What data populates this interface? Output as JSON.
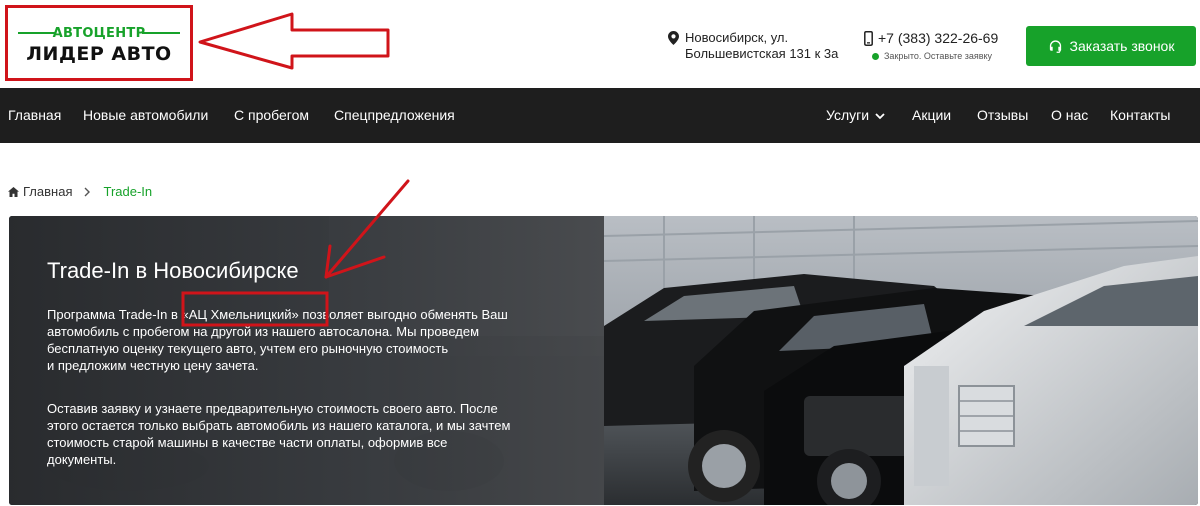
{
  "header": {
    "logo_top": "АВТОЦЕНТР",
    "logo_bottom": "ЛИДЕР АВТО",
    "address_line1": "Новосибирск, ул.",
    "address_line2": "Большевистская 131 к 3а",
    "phone": "+7 (383) 322-26-69",
    "phone_status": "Закрыто. Оставьте заявку",
    "call_button": "Заказать звонок",
    "icons": {
      "address": "map-pin-icon",
      "phone": "mobile-phone-icon",
      "call": "headset-icon"
    },
    "colors": {
      "accent": "#17a22a",
      "annotation": "#d0141a"
    }
  },
  "nav": {
    "left": [
      "Главная",
      "Новые автомобили",
      "С пробегом",
      "Спецпредложения"
    ],
    "right": [
      "Услуги",
      "Акции",
      "Отзывы",
      "О нас",
      "Контакты"
    ]
  },
  "breadcrumb": {
    "home": "Главная",
    "current": "Trade-In"
  },
  "hero": {
    "title": "Trade-In в Новосибирске",
    "p1_lines": [
      "Программа Trade-In в «АЦ Хмельницкий» позволяет выгодно обменять Ваш",
      "автомобиль с пробегом на другой из нашего автосалона. Мы проведем",
      "бесплатную оценку текущего авто, учтем его рыночную стоимость",
      "и предложим честную цену зачета."
    ],
    "p2_lines": [
      "Оставив заявку и узнаете предварительную стоимость своего авто. После",
      "этого остается только выбрать автомобиль из нашего каталога, и мы зачтем",
      "стоимость старой машины в качестве части оплаты, оформив все",
      "документы."
    ]
  }
}
